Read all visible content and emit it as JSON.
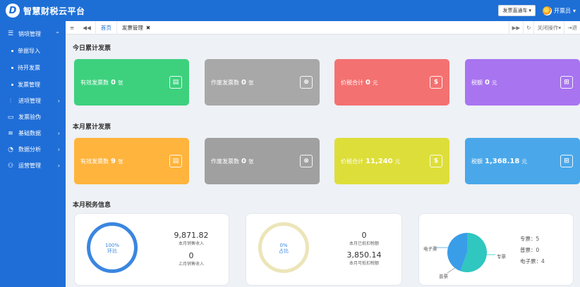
{
  "app": {
    "title": "智慧财税云平台",
    "logo_letter": "D"
  },
  "topbar": {
    "dropdown_label": "发票直通车",
    "dropdown_arrow": "▾",
    "user_name": "开票员",
    "user_arrow": "▾"
  },
  "sidebar": {
    "sales": {
      "icon": "☰",
      "label": "销项管理",
      "chevron": "⌃"
    },
    "sub_items": [
      "单据导入",
      "待开发票",
      "发票管理"
    ],
    "items": [
      {
        "icon": "⫶",
        "label": "进项管理",
        "chevron": "›"
      },
      {
        "icon": "▭",
        "label": "发票验伪",
        "chevron": ""
      },
      {
        "icon": "≋",
        "label": "基础数据",
        "chevron": "›"
      },
      {
        "icon": "◔",
        "label": "数据分析",
        "chevron": "›"
      },
      {
        "icon": "⚇",
        "label": "运营管理",
        "chevron": "›"
      }
    ]
  },
  "tabbar": {
    "menu_icon": "≡",
    "back_icon": "◀◀",
    "tabs": [
      {
        "label": "首页"
      },
      {
        "label": "发票管理",
        "close": "✖"
      }
    ],
    "forward_icon": "▶▶",
    "refresh_icon": "↻",
    "close_ops": "关闭操作▾",
    "exit": "⇥退"
  },
  "today": {
    "title": "今日累计发票",
    "cards": [
      {
        "label": "有效发票数",
        "value": "0",
        "unit": "张",
        "color": "#3dd17e",
        "icon": "▤"
      },
      {
        "label": "作废发票数",
        "value": "0",
        "unit": "张",
        "color": "#a8a8a8",
        "icon": "⊗"
      },
      {
        "label": "价税合计",
        "value": "0",
        "unit": "元",
        "color": "#f47171",
        "icon": "$"
      },
      {
        "label": "税额",
        "value": "0",
        "unit": "元",
        "color": "#a874f0",
        "icon": "⊞"
      }
    ]
  },
  "month": {
    "title": "本月累计发票",
    "cards": [
      {
        "label": "有效发票数",
        "value": "9",
        "unit": "张",
        "color": "#ffb43d",
        "icon": "▤"
      },
      {
        "label": "作废发票数",
        "value": "0",
        "unit": "张",
        "color": "#a0a0a0",
        "icon": "⊗"
      },
      {
        "label": "价税合计",
        "value": "11,240",
        "unit": "元",
        "color": "#dede3a",
        "icon": "$"
      },
      {
        "label": "税额",
        "value": "1,368.18",
        "unit": "元",
        "color": "#4aa8ea",
        "icon": "⊞"
      }
    ]
  },
  "tax": {
    "title": "本月税务信息",
    "panel1": {
      "ring_pct": "100%",
      "ring_caption": "环比",
      "value1": "9,871.82",
      "caption1": "本月销售收入",
      "value2": "0",
      "caption2": "上月销售收入"
    },
    "panel2": {
      "ring_pct": "0%",
      "ring_caption": "占比",
      "value1": "0",
      "caption1": "本月已抵扣税额",
      "value2": "3,850.14",
      "caption2": "本月可抵扣税额"
    },
    "panel3": {
      "pie_labels": {
        "electronic": "电子票",
        "special": "专票",
        "normal": "普票"
      },
      "legend": [
        "专票：5",
        "普票：0",
        "电子票：4"
      ],
      "counts": {
        "special": 5,
        "normal": 0,
        "electronic": 4
      },
      "colors": {
        "special": "#2fc7c0",
        "electronic": "#3a9de8"
      }
    }
  }
}
